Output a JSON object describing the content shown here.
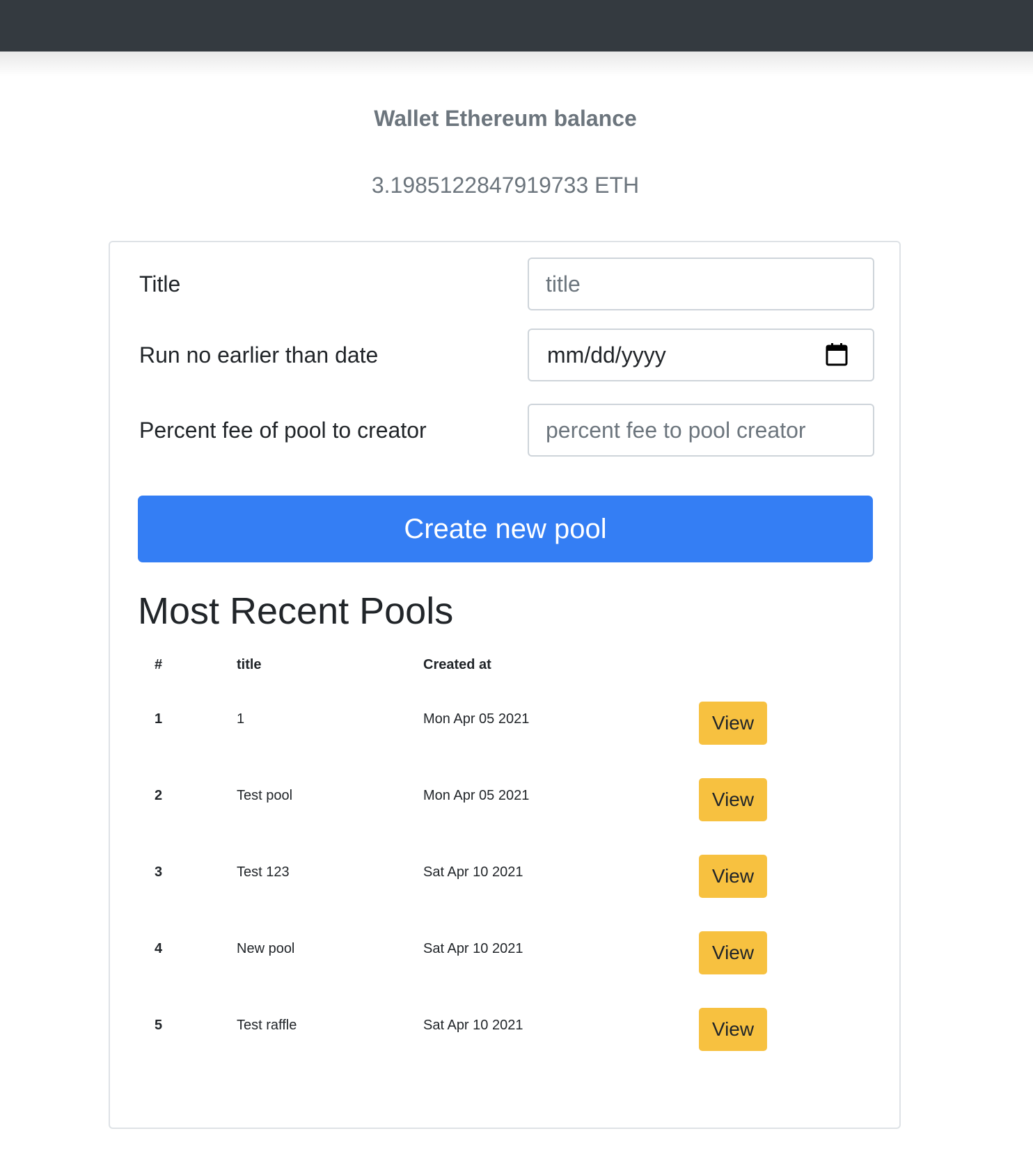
{
  "wallet": {
    "heading": "Wallet Ethereum balance",
    "balance": "3.1985122847919733 ETH"
  },
  "form": {
    "title_label": "Title",
    "title_placeholder": "title",
    "date_label": "Run no earlier than date",
    "date_placeholder": "mm/dd/yyyy",
    "fee_label": "Percent fee of pool to creator",
    "fee_placeholder": "percent fee to pool creator",
    "submit_label": "Create new pool"
  },
  "pools": {
    "heading": "Most Recent Pools",
    "columns": [
      "#",
      "title",
      "Created at"
    ],
    "rows": [
      {
        "num": "1",
        "title": "1",
        "created": "Mon Apr 05 2021",
        "action": "View"
      },
      {
        "num": "2",
        "title": "Test pool",
        "created": "Mon Apr 05 2021",
        "action": "View"
      },
      {
        "num": "3",
        "title": "Test 123",
        "created": "Sat Apr 10 2021",
        "action": "View"
      },
      {
        "num": "4",
        "title": "New pool",
        "created": "Sat Apr 10 2021",
        "action": "View"
      },
      {
        "num": "5",
        "title": "Test raffle",
        "created": "Sat Apr 10 2021",
        "action": "View"
      }
    ]
  },
  "icons": {
    "date_picker": "calendar-icon"
  },
  "colors": {
    "navbar": "#343a40",
    "primary_button": "#347ef4",
    "view_button": "#f7c140",
    "muted_text": "#6c757d"
  }
}
